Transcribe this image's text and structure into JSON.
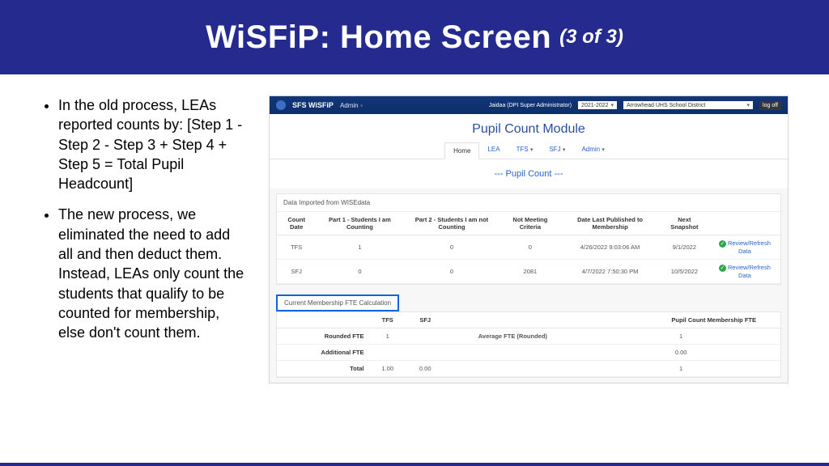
{
  "slide": {
    "title": "WiSFiP: Home Screen",
    "counter": "(3 of 3)",
    "bullets": [
      "In the old process, LEAs reported counts by: [Step 1 - Step 2 - Step 3 + Step 4 + Step 5 = Total Pupil Headcount]",
      "The new process, we eliminated the need to add all and then deduct them.  Instead, LEAs only count the students that qualify to be counted for membership, else don't count them."
    ]
  },
  "app": {
    "brand": "SFS WiSFiP",
    "admin_menu": "Admin",
    "user_label": "Jaidaa (DPI Super Administrator)",
    "year_select": "2021-2022",
    "district_select": "Arrowhead UHS School District",
    "logoff": "log off",
    "module_title": "Pupil Count Module",
    "tabs": {
      "home": "Home",
      "lea": "LEA",
      "tfs": "TFS",
      "sfj": "SFJ",
      "admin": "Admin"
    },
    "pupil_count_label": "--- Pupil Count ---",
    "panel1": {
      "title": "Data Imported from WISEdata",
      "headers": {
        "count_date": "Count Date",
        "part1": "Part 1 - Students I am Counting",
        "part2": "Part 2 - Students I am not Counting",
        "not_meeting": "Not Meeting Criteria",
        "date_pub": "Date Last Published to Membership",
        "next_snap": "Next Snapshot",
        "action": ""
      },
      "rows": [
        {
          "count_date": "TFS",
          "part1": "1",
          "part2": "0",
          "not_meeting": "0",
          "date_pub": "4/26/2022 9:03:06 AM",
          "next_snap": "9/1/2022",
          "action": "Review/Refresh Data"
        },
        {
          "count_date": "SFJ",
          "part1": "0",
          "part2": "0",
          "not_meeting": "2081",
          "date_pub": "4/7/2022 7:50:30 PM",
          "next_snap": "10/5/2022",
          "action": "Review/Refresh Data"
        }
      ]
    },
    "panel2": {
      "title": "Current Membership FTE Calculation",
      "cols": {
        "tfs": "TFS",
        "sfj": "SFJ",
        "avg": "Average FTE (Rounded)",
        "mem": "Pupil Count Membership FTE"
      },
      "rows": {
        "rounded": {
          "label": "Rounded FTE",
          "tfs": "1",
          "sfj": "",
          "mem": "1"
        },
        "additional": {
          "label": "Additional FTE",
          "tfs": "",
          "sfj": "",
          "mem": "0.00"
        },
        "total": {
          "label": "Total",
          "tfs": "1.00",
          "sfj": "0.00",
          "mem": "1"
        }
      }
    }
  }
}
